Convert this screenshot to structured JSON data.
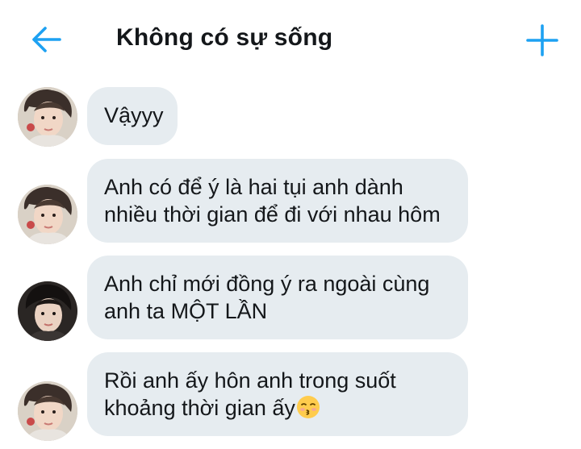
{
  "header": {
    "title": "Không có sự sống",
    "back_icon": "arrow-left-icon",
    "add_icon": "plus-icon",
    "accent_color": "#1da1f2"
  },
  "messages": [
    {
      "avatar": "avatar-boy-light",
      "lines": [
        "Vậyyy"
      ]
    },
    {
      "avatar": "avatar-boy-light",
      "lines": [
        "Anh có để ý là hai tụi anh dành",
        "nhiều thời gian để đi với nhau hôm"
      ]
    },
    {
      "avatar": "avatar-boy-dark",
      "lines": [
        "Anh chỉ mới đồng ý ra ngoài cùng",
        "anh ta MỘT LẦN"
      ]
    },
    {
      "avatar": "avatar-boy-light",
      "lines": [
        "Rồi anh ấy hôn anh trong suốt",
        "khoảng thời gian ấy"
      ],
      "emoji": "kissing-face-emoji"
    }
  ],
  "colors": {
    "bubble_bg": "#e6ecf0",
    "text": "#14171a"
  }
}
